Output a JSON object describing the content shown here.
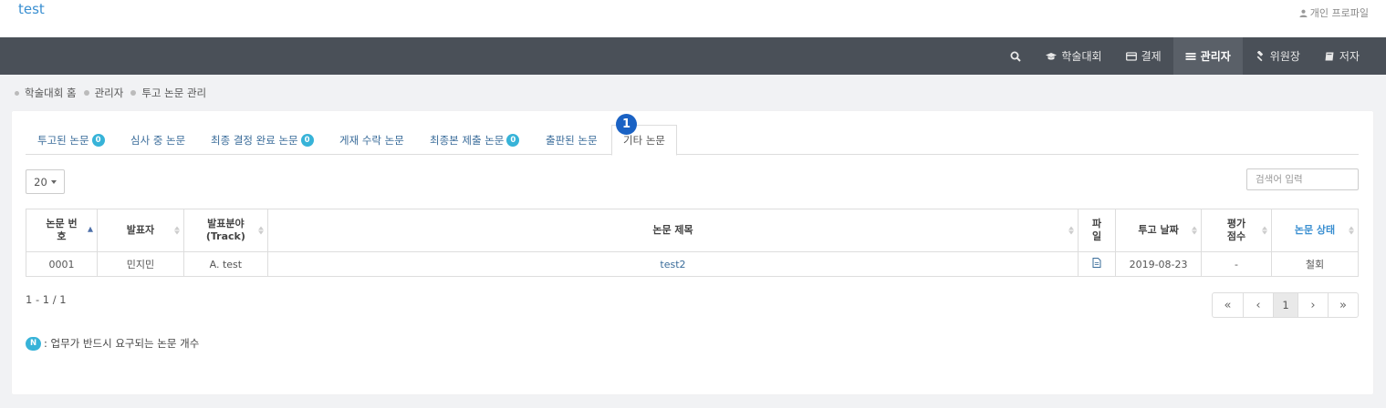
{
  "header": {
    "site_title": "test",
    "profile_label": "개인 프로파일"
  },
  "nav": {
    "items": [
      {
        "label": "학술대회",
        "icon": "graduation-cap-icon"
      },
      {
        "label": "결제",
        "icon": "credit-card-icon"
      },
      {
        "label": "관리자",
        "icon": "list-icon",
        "active": true
      },
      {
        "label": "위원장",
        "icon": "gavel-icon"
      },
      {
        "label": "저자",
        "icon": "book-icon"
      }
    ]
  },
  "breadcrumb": [
    "학술대회 홈",
    "관리자",
    "투고 논문 관리"
  ],
  "tabs": [
    {
      "label": "투고된 논문",
      "badge": "0"
    },
    {
      "label": "심사 중 논문"
    },
    {
      "label": "최종 결정 완료 논문",
      "badge": "0"
    },
    {
      "label": "게재 수락 논문"
    },
    {
      "label": "최종본 제출 논문",
      "badge": "0"
    },
    {
      "label": "출판된 논문"
    },
    {
      "label": "기타 논문",
      "active": true
    }
  ],
  "step_marker": "1",
  "controls": {
    "page_size": "20",
    "search_placeholder": "검색어 입력"
  },
  "table": {
    "headers": [
      {
        "line1": "논문 번",
        "line2": "호"
      },
      {
        "line1": "발표자"
      },
      {
        "line1": "발표분야",
        "line2": "(Track)"
      },
      {
        "line1": "논문 제목"
      },
      {
        "line1": "파",
        "line2": "일"
      },
      {
        "line1": "투고 날짜"
      },
      {
        "line1": "평가",
        "line2": "점수"
      },
      {
        "line1": "논문 상태"
      }
    ],
    "rows": [
      {
        "number": "0001",
        "presenter": "민지민",
        "track": "A. test",
        "title": "test2",
        "file_icon": "file-icon",
        "date": "2019-08-23",
        "score": "-",
        "status": "철회"
      }
    ]
  },
  "footer": {
    "range": "1 - 1 / 1",
    "pagination": {
      "first": "«",
      "prev": "‹",
      "current": "1",
      "next": "›",
      "last": "»"
    },
    "legend_badge": "N",
    "legend_text": ": 업무가 반드시 요구되는 논문 개수"
  },
  "colors": {
    "nav_bg": "#4a5058",
    "badge": "#37b3d8",
    "link": "#3a6c9a",
    "step_marker": "#1a62c4"
  }
}
